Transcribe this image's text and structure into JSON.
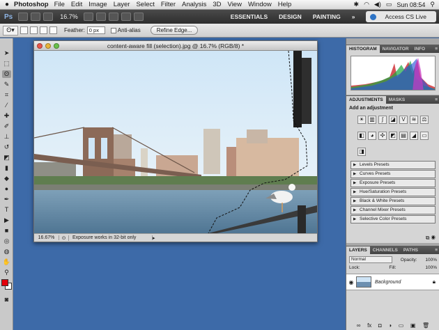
{
  "menubar": {
    "apple": "",
    "app": "Photoshop",
    "items": [
      "File",
      "Edit",
      "Image",
      "Layer",
      "Select",
      "Filter",
      "Analysis",
      "3D",
      "View",
      "Window",
      "Help"
    ],
    "clock": "Sun 08:54"
  },
  "appbar": {
    "logo": "Ps",
    "zoom": "16.7%",
    "workspaces": [
      "ESSENTIALS",
      "DESIGN",
      "PAINTING"
    ],
    "more": "»",
    "cs_live": "Access CS Live"
  },
  "options": {
    "feather_label": "Feather:",
    "feather_value": "0 px",
    "antialias_label": "Anti-alias",
    "refine_edge": "Refine Edge..."
  },
  "document": {
    "title": "content-aware fill (selection).jpg @ 16.7% (RGB/8) *",
    "zoom": "16.67%",
    "status": "Exposure works in 32-bit only"
  },
  "histogram": {
    "tabs": [
      "HISTOGRAM",
      "NAVIGATOR",
      "INFO"
    ]
  },
  "adjustments": {
    "tabs": [
      "ADJUSTMENTS",
      "MASKS"
    ],
    "header": "Add an adjustment",
    "presets": [
      "Levels Presets",
      "Curves Presets",
      "Exposure Presets",
      "Hue/Saturation Presets",
      "Black & White Presets",
      "Channel Mixer Presets",
      "Selective Color Presets"
    ]
  },
  "layers": {
    "tabs": [
      "LAYERS",
      "CHANNELS",
      "PATHS"
    ],
    "blend_mode": "Normal",
    "opacity_label": "Opacity:",
    "opacity_value": "100%",
    "lock_label": "Lock:",
    "fill_label": "Fill:",
    "fill_value": "100%",
    "layer_name": "Background"
  },
  "colors": {
    "foreground": "#e3000b",
    "background": "#ffffff",
    "desktop": "#3d6aa8"
  }
}
